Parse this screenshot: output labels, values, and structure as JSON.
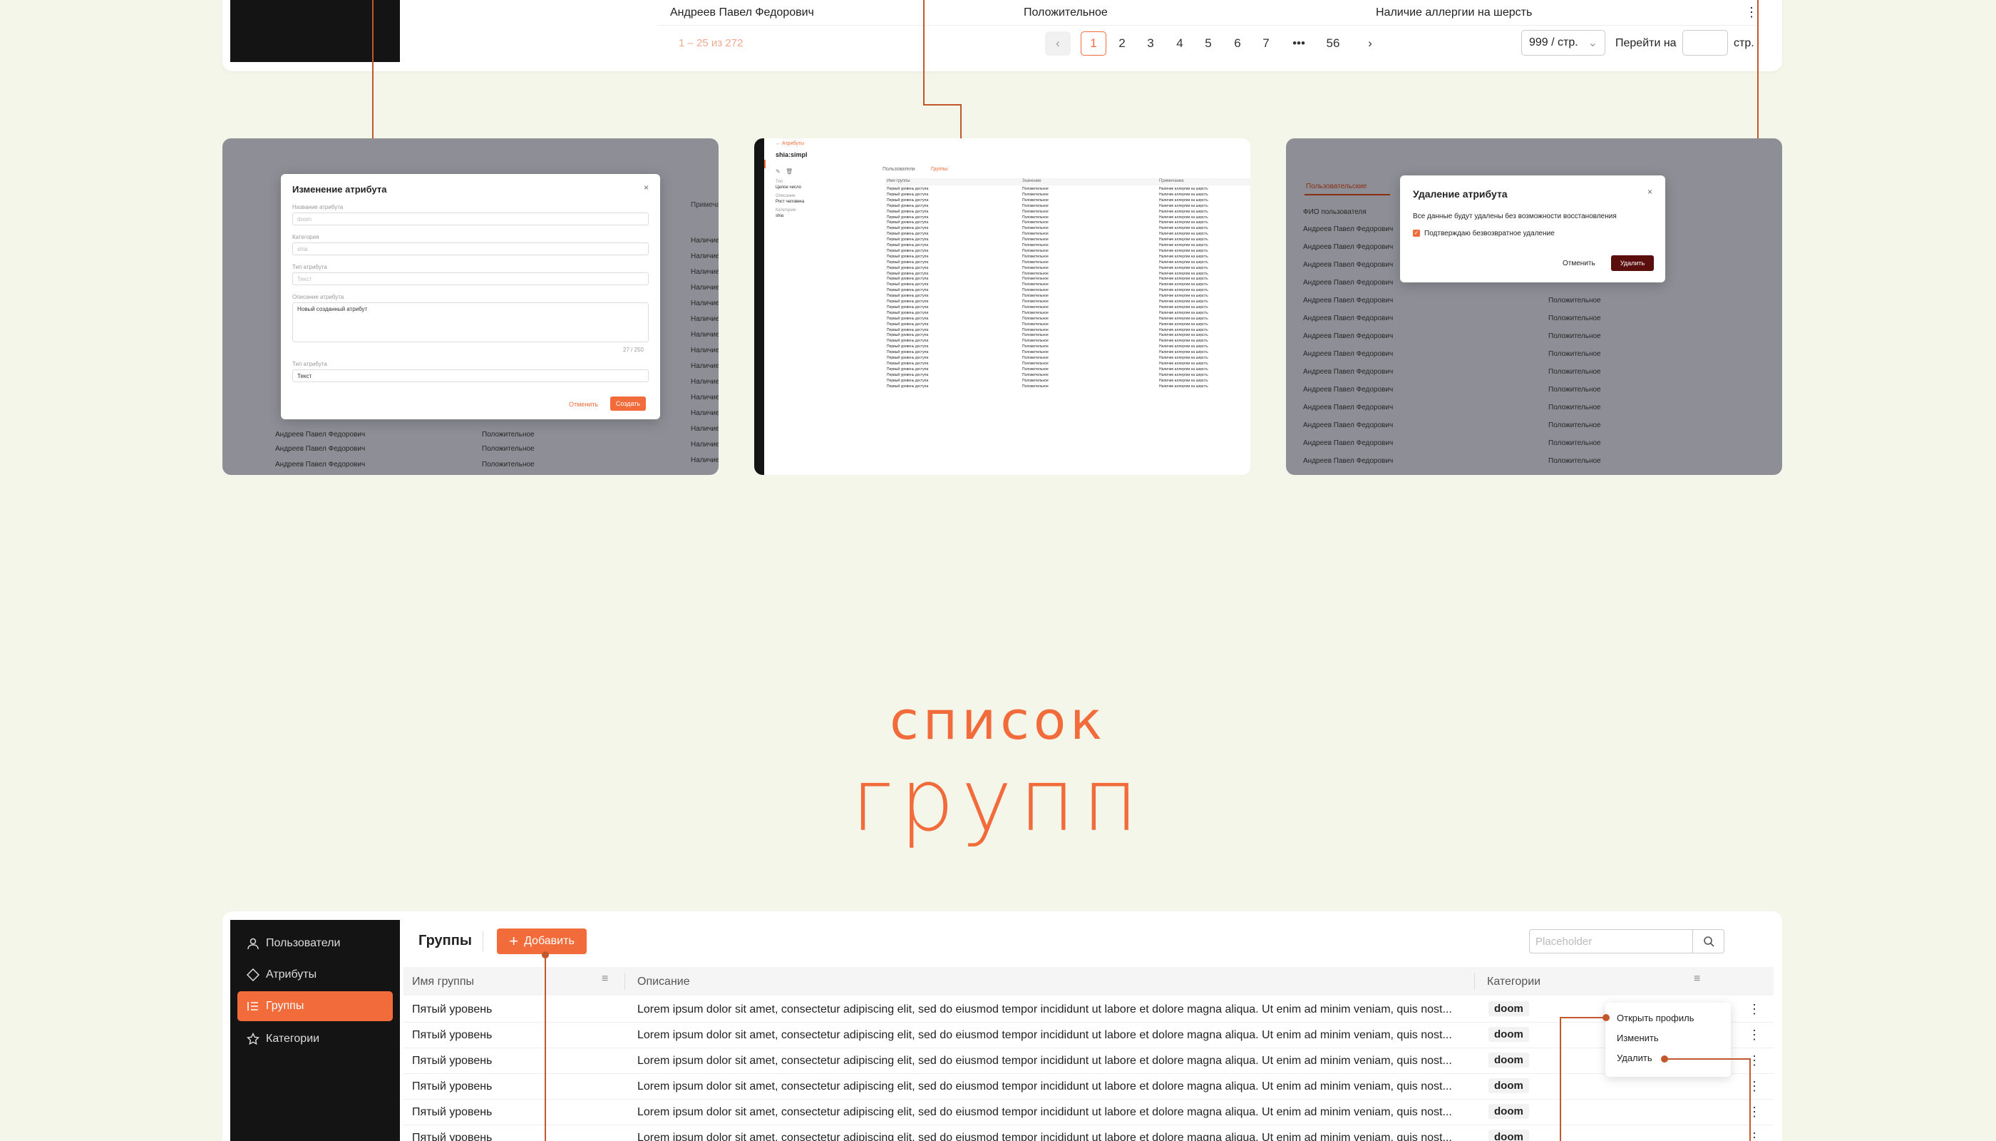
{
  "top_table": {
    "row": {
      "name": "Андреев Павел Федорович",
      "value": "Положительное",
      "attribute": "Наличие аллергии на шерсть"
    },
    "pager": {
      "count": "1 – 25 из 272",
      "pages": [
        "1",
        "2",
        "3",
        "4",
        "5",
        "6",
        "7",
        "•••",
        "56"
      ],
      "page_size": "999 / стр.",
      "goto_label": "Перейти на",
      "unit": "стр."
    }
  },
  "thumb1": {
    "modal_title": "Изменение атрибута",
    "labels": [
      "Название атрибута",
      "Категория",
      "Тип атрибута",
      "Описание атрибута",
      "Тип атрибута"
    ],
    "fields": [
      "doom",
      "shia",
      "Текст",
      "Новый созданный атрибут",
      "Текст"
    ],
    "counter": "27 / 250",
    "cancel": "Отменить",
    "create": "Создать",
    "bg_rows": [
      "Андреев Павел Федорович",
      "Андреев Павел Федорович",
      "Андреев Павел Федорович"
    ],
    "bg_value": "Положительное",
    "bg_col": "Наличие",
    "bg_header": "Примечан"
  },
  "thumb2": {
    "breadcrumb": "← Атрибуты",
    "title": "shia:simpl",
    "tabs": [
      "Пользователи",
      "Группы"
    ],
    "side_labels": [
      "Тип",
      "Целое число",
      "Описание",
      "Рост человека",
      "Категория",
      "shia"
    ],
    "headers": [
      "Имя группы",
      "Значение",
      "Примечание"
    ],
    "cell_group": "Первый уровень доступа",
    "cell_value": "Положительное",
    "cell_note": "Наличие аллергии на шерсть"
  },
  "thumb3": {
    "tab": "Пользовательские",
    "col_header": "ФИО пользователя",
    "row_name": "Андреев Павел Федорович",
    "row_value": "Положительное",
    "modal_title": "Удаление атрибута",
    "modal_text": "Все данные будут удалены без возможности восстановления",
    "checkbox_label": "Подтверждаю безвозвратное удаление",
    "cancel": "Отменить",
    "delete": "Удалить"
  },
  "heading": {
    "line1": "список",
    "line2": "групп"
  },
  "sidebar": {
    "items": [
      {
        "label": "Пользователи",
        "icon": "user-icon"
      },
      {
        "label": "Атрибуты",
        "icon": "attribute-icon"
      },
      {
        "label": "Группы",
        "icon": "list-icon",
        "active": true
      },
      {
        "label": "Категории",
        "icon": "star-icon"
      }
    ]
  },
  "groups": {
    "title": "Группы",
    "add_label": "Добавить",
    "search_placeholder": "Placeholder",
    "columns": [
      "Имя группы",
      "Описание",
      "Категории"
    ],
    "rows": [
      {
        "name": "Пятый уровень",
        "desc": "Lorem ipsum dolor sit amet, consectetur adipiscing elit, sed do eiusmod tempor incididunt ut labore et dolore magna aliqua. Ut enim ad minim veniam, quis nost...",
        "category": "doom"
      },
      {
        "name": "Пятый уровень",
        "desc": "Lorem ipsum dolor sit amet, consectetur adipiscing elit, sed do eiusmod tempor incididunt ut labore et dolore magna aliqua. Ut enim ad minim veniam, quis nost...",
        "category": "doom"
      },
      {
        "name": "Пятый уровень",
        "desc": "Lorem ipsum dolor sit amet, consectetur adipiscing elit, sed do eiusmod tempor incididunt ut labore et dolore magna aliqua. Ut enim ad minim veniam, quis nost...",
        "category": "doom"
      },
      {
        "name": "Пятый уровень",
        "desc": "Lorem ipsum dolor sit amet, consectetur adipiscing elit, sed do eiusmod tempor incididunt ut labore et dolore magna aliqua. Ut enim ad minim veniam, quis nost...",
        "category": "doom"
      },
      {
        "name": "Пятый уровень",
        "desc": "Lorem ipsum dolor sit amet, consectetur adipiscing elit, sed do eiusmod tempor incididunt ut labore et dolore magna aliqua. Ut enim ad minim veniam, quis nost...",
        "category": "doom"
      },
      {
        "name": "Пятый уровень",
        "desc": "Lorem ipsum dolor sit amet, consectetur adipiscing elit, sed do eiusmod tempor incididunt ut labore et dolore magna aliqua. Ut enim ad minim veniam, quis nost...",
        "category": "doom"
      }
    ],
    "context_menu": [
      "Открыть профиль",
      "Изменить",
      "Удалить"
    ]
  },
  "colors": {
    "accent": "#f26b3a",
    "dark_accent": "#5a0e0e",
    "background": "#f5f6ea",
    "sidebar": "#141414"
  }
}
